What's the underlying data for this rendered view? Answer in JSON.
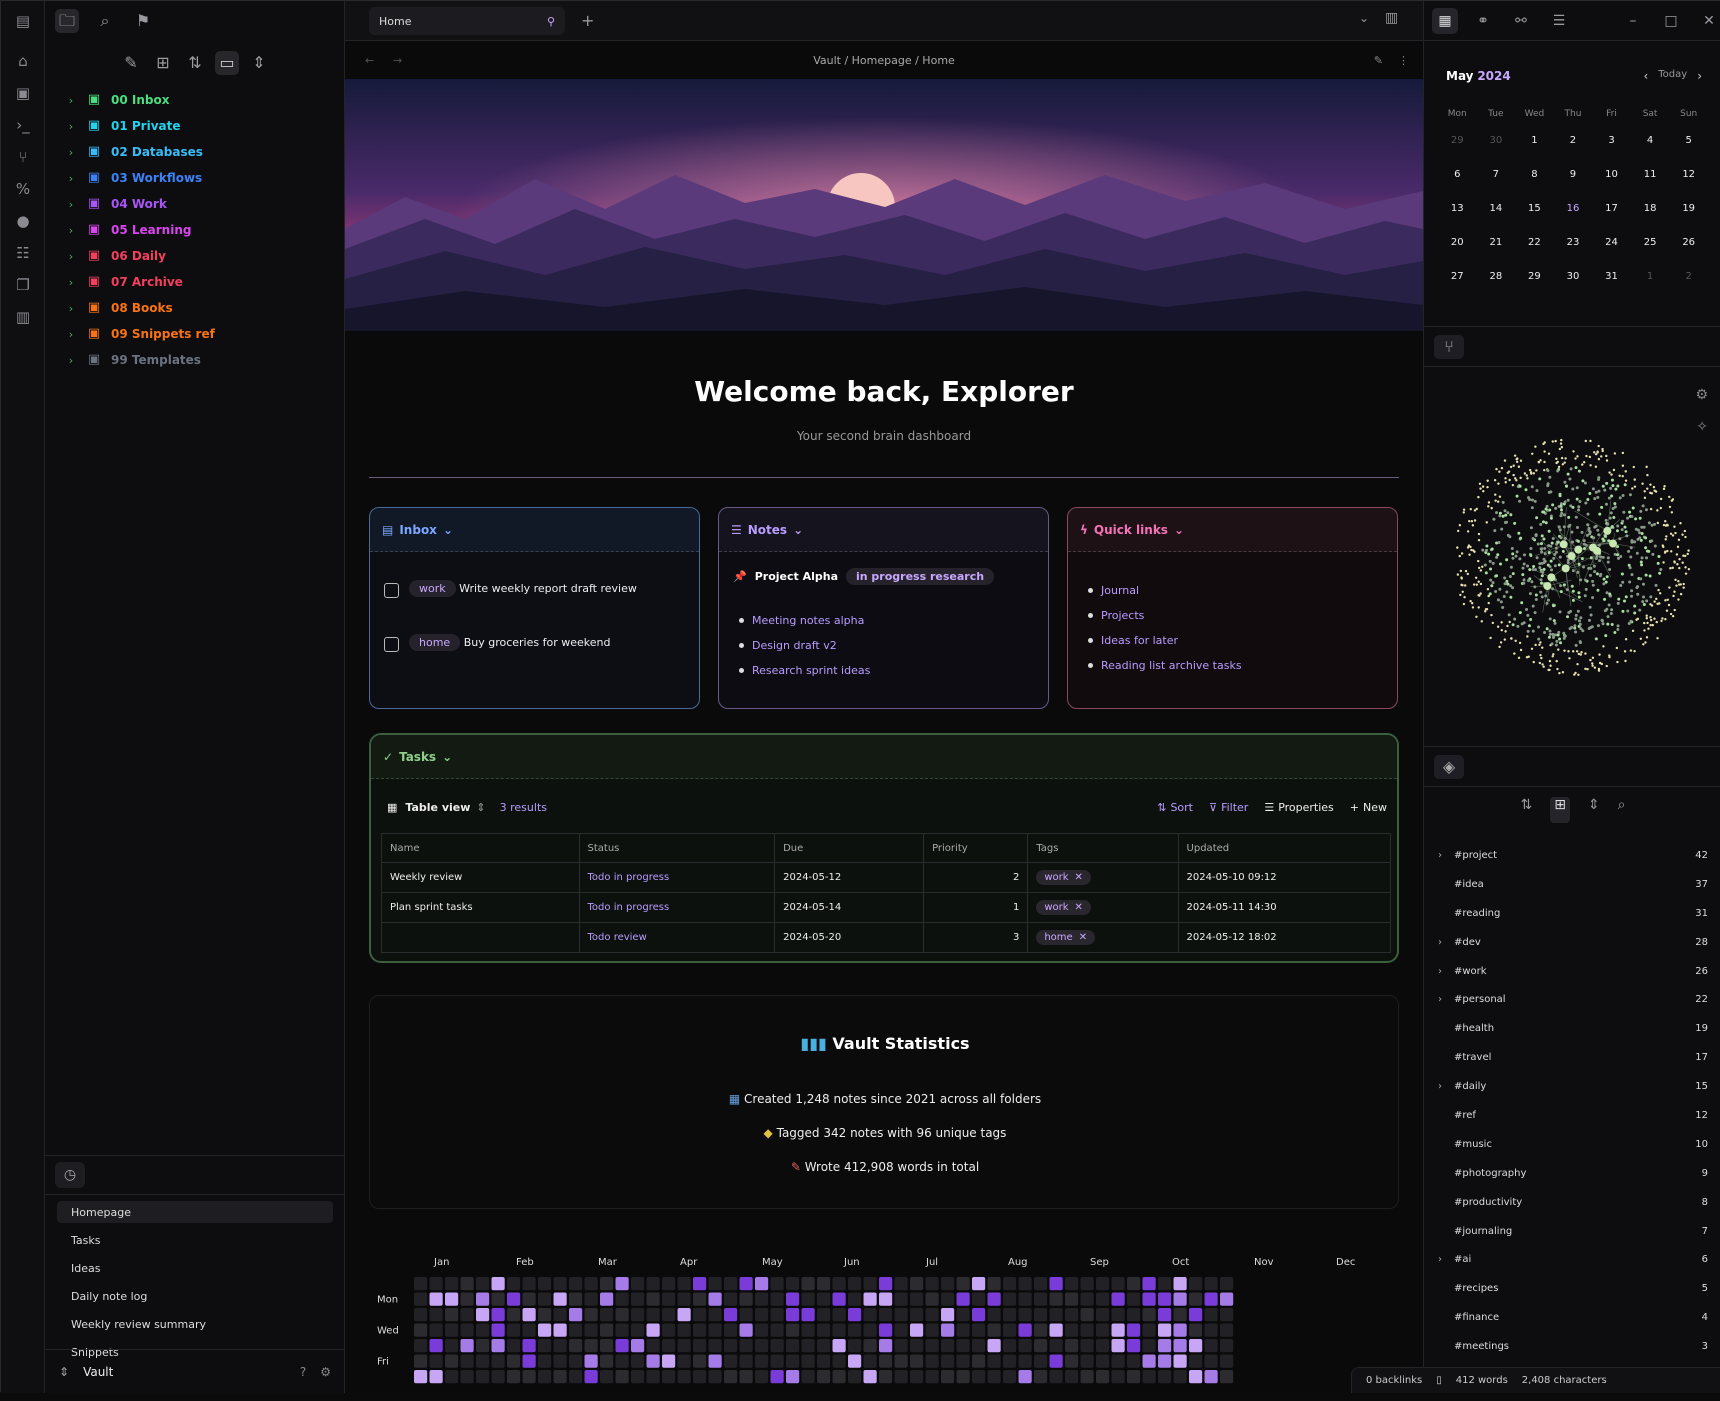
{
  "sidebar": {
    "tree": [
      {
        "label": "00 Inbox",
        "color": "#4ade80",
        "icon": "git-branch-icon"
      },
      {
        "label": "01 Private",
        "color": "#22d3ee",
        "icon": "lock-icon"
      },
      {
        "label": "02 Databases",
        "color": "#38bdf8",
        "icon": "database-icon"
      },
      {
        "label": "03 Workflows",
        "color": "#3b82f6",
        "icon": "workflow-icon"
      },
      {
        "label": "04 Work",
        "color": "#a855f7",
        "icon": "briefcase-icon"
      },
      {
        "label": "05 Learning",
        "color": "#d946ef",
        "icon": "graduation-cap-icon"
      },
      {
        "label": "06 Daily",
        "color": "#f43f5e",
        "icon": "calendar-icon"
      },
      {
        "label": "07 Archive",
        "color": "#f43f5e",
        "icon": "archive-icon"
      },
      {
        "label": "08 Books",
        "color": "#f97316",
        "icon": "book-icon"
      },
      {
        "label": "09 Snippets ref",
        "color": "#f97316",
        "icon": "dashed-link-icon"
      },
      {
        "label": "99 Templates",
        "color": "#6b7280",
        "icon": "template-icon"
      }
    ],
    "recent": [
      "Homepage",
      "Tasks",
      "Ideas",
      "Daily note log",
      "Weekly review summary",
      "Snippets"
    ],
    "vault_name": "Vault"
  },
  "tab": {
    "title": "Home"
  },
  "breadcrumb": "Vault / Homepage / Home",
  "page": {
    "title": "Welcome back, Explorer",
    "subtitle": "Your second brain dashboard"
  },
  "cards": [
    {
      "title": "Inbox",
      "color": "#7aa7ff",
      "tasks": [
        {
          "chip": "work",
          "text": "Write weekly report draft review"
        },
        {
          "chip": "home",
          "text": "Buy groceries for weekend"
        }
      ]
    },
    {
      "title": "Notes",
      "color": "#b99cff",
      "heading": "Project Alpha",
      "tag": "in progress research",
      "bullets": [
        "Meeting notes alpha",
        "Design draft v2",
        "Research sprint ideas"
      ]
    },
    {
      "title": "Quick links",
      "color": "#f472b6",
      "bullets": [
        "Journal",
        "Projects",
        "Ideas for later",
        "Reading list archive tasks"
      ]
    }
  ],
  "base": {
    "title": "Tasks",
    "view": "Table view",
    "count": "3 results",
    "tools": [
      "Sort",
      "Filter",
      "Properties",
      "New"
    ],
    "columns": [
      "Name",
      "Status",
      "Due",
      "Priority",
      "Tags",
      "Updated"
    ],
    "rows": [
      {
        "name": "Weekly review",
        "status": "Todo in progress",
        "due": "2024-05-12",
        "prio": "2",
        "tag": "work",
        "updated": "2024-05-10 09:12"
      },
      {
        "name": "Plan sprint tasks",
        "status": "Todo in progress",
        "due": "2024-05-14",
        "prio": "1",
        "tag": "work",
        "updated": "2024-05-11 14:30"
      },
      {
        "name": "",
        "status": "Todo review",
        "due": "2024-05-20",
        "prio": "3",
        "tag": "home",
        "updated": "2024-05-12 18:02"
      }
    ]
  },
  "stats": {
    "heading": "Vault Statistics",
    "lines": [
      "Created 1,248 notes since 2021 across all folders",
      "Tagged 342 notes with 96 unique tags",
      "Wrote 412,908 words in total"
    ]
  },
  "heatmap": {
    "months": [
      "Jan",
      "Feb",
      "Mar",
      "Apr",
      "May",
      "Jun",
      "Jul",
      "Aug",
      "Sep",
      "Oct",
      "Nov",
      "Dec"
    ],
    "days": [
      "Mon",
      "Wed",
      "Fri"
    ]
  },
  "calendar": {
    "month": "May",
    "year": "2024",
    "weekdays": [
      "Mon",
      "Tue",
      "Wed",
      "Thu",
      "Fri",
      "Sat",
      "Sun"
    ],
    "weeks": [
      [
        "29",
        "30",
        "1",
        "2",
        "3",
        "4",
        "5"
      ],
      [
        "6",
        "7",
        "8",
        "9",
        "10",
        "11",
        "12"
      ],
      [
        "13",
        "14",
        "15",
        "16",
        "17",
        "18",
        "19"
      ],
      [
        "20",
        "21",
        "22",
        "23",
        "24",
        "25",
        "26"
      ],
      [
        "27",
        "28",
        "29",
        "30",
        "31",
        "1",
        "2"
      ]
    ]
  },
  "tags": [
    {
      "name": "#project",
      "count": "42",
      "collapsible": true
    },
    {
      "name": "#idea",
      "count": "37",
      "collapsible": false
    },
    {
      "name": "#reading",
      "count": "31",
      "collapsible": false
    },
    {
      "name": "#dev",
      "count": "28",
      "collapsible": true
    },
    {
      "name": "#work",
      "count": "26",
      "collapsible": true
    },
    {
      "name": "#personal",
      "count": "22",
      "collapsible": true
    },
    {
      "name": "#health",
      "count": "19",
      "collapsible": false
    },
    {
      "name": "#travel",
      "count": "17",
      "collapsible": false
    },
    {
      "name": "#daily",
      "count": "15",
      "collapsible": true
    },
    {
      "name": "#ref",
      "count": "12",
      "collapsible": false
    },
    {
      "name": "#music",
      "count": "10",
      "collapsible": false
    },
    {
      "name": "#photography",
      "count": "9",
      "collapsible": false
    },
    {
      "name": "#productivity",
      "count": "8",
      "collapsible": false
    },
    {
      "name": "#journaling",
      "count": "7",
      "collapsible": false
    },
    {
      "name": "#ai",
      "count": "6",
      "collapsible": true
    },
    {
      "name": "#recipes",
      "count": "5",
      "collapsible": false
    },
    {
      "name": "#finance",
      "count": "4",
      "collapsible": false
    },
    {
      "name": "#meetings",
      "count": "3",
      "collapsible": false
    }
  ],
  "status": {
    "backlinks": "0 backlinks",
    "words": "412 words",
    "chars": "2,408 characters"
  }
}
